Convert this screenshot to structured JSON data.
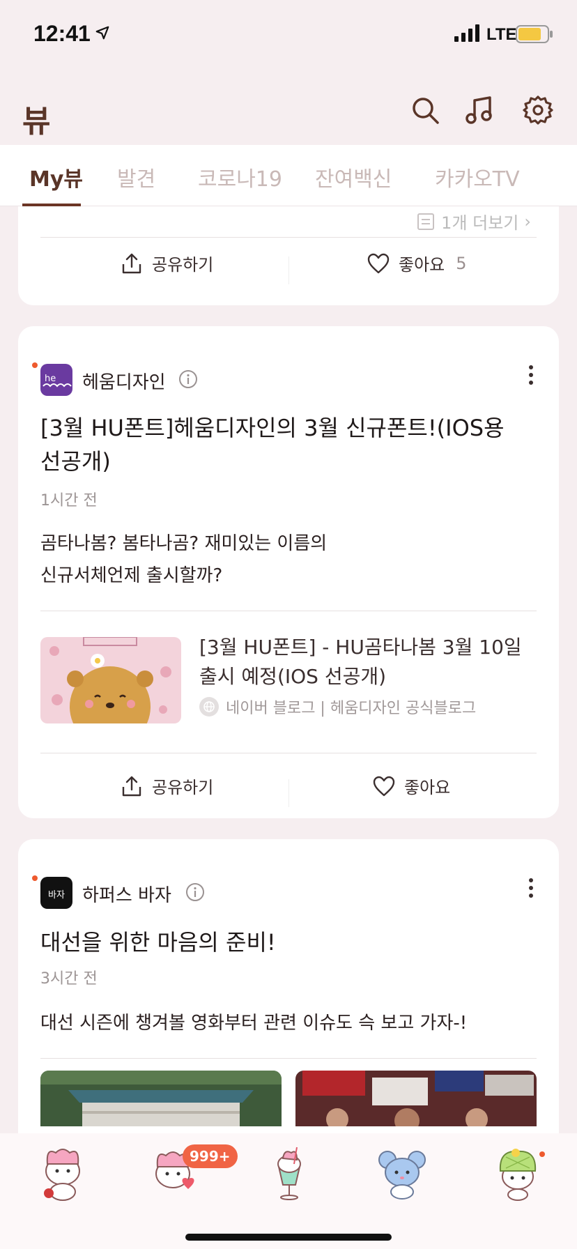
{
  "status_bar": {
    "time": "12:41",
    "network": "LTE"
  },
  "header": {
    "app_title": "뷰"
  },
  "tabs": [
    {
      "label": "My뷰",
      "active": true
    },
    {
      "label": "발견",
      "active": false
    },
    {
      "label": "코로나19",
      "active": false
    },
    {
      "label": "잔여백신",
      "active": false
    },
    {
      "label": "카카오TV",
      "active": false
    }
  ],
  "cards": {
    "top": {
      "more_label": "1개 더보기",
      "share_label": "공유하기",
      "like_label": "좋아요",
      "like_count": "5"
    },
    "c2": {
      "publisher": "헤움디자인",
      "logo_text": "he",
      "title": "[3월 HU폰트]헤움디자인의 3월 신규폰트!(IOS용 선공개)",
      "time": "1시간 전",
      "text_line1": "곰타나봄? 봄타나곰? 재미있는 이름의",
      "text_line2": "신규서체언제 출시할까?",
      "link_title": "[3월 HU폰트] - HU곰타나봄 3월 10일 출시 예정(IOS 선공개)",
      "link_source": "네이버 블로그 | 헤움디자인 공식블로그",
      "share_label": "공유하기",
      "like_label": "좋아요"
    },
    "c3": {
      "publisher": "하퍼스 바자",
      "logo_text": "바자",
      "title": "대선을 위한 마음의 준비!",
      "time": "3시간 전",
      "text": "대선 시즌에 챙겨볼 영화부터 관련 이슈도 슥 보고 가자-!"
    }
  },
  "tabbar": {
    "badge": "999+"
  },
  "colors": {
    "accent": "#6c3525",
    "badge": "#f06445",
    "background": "#f6eef0",
    "new_dot": "#ee5a2e"
  }
}
